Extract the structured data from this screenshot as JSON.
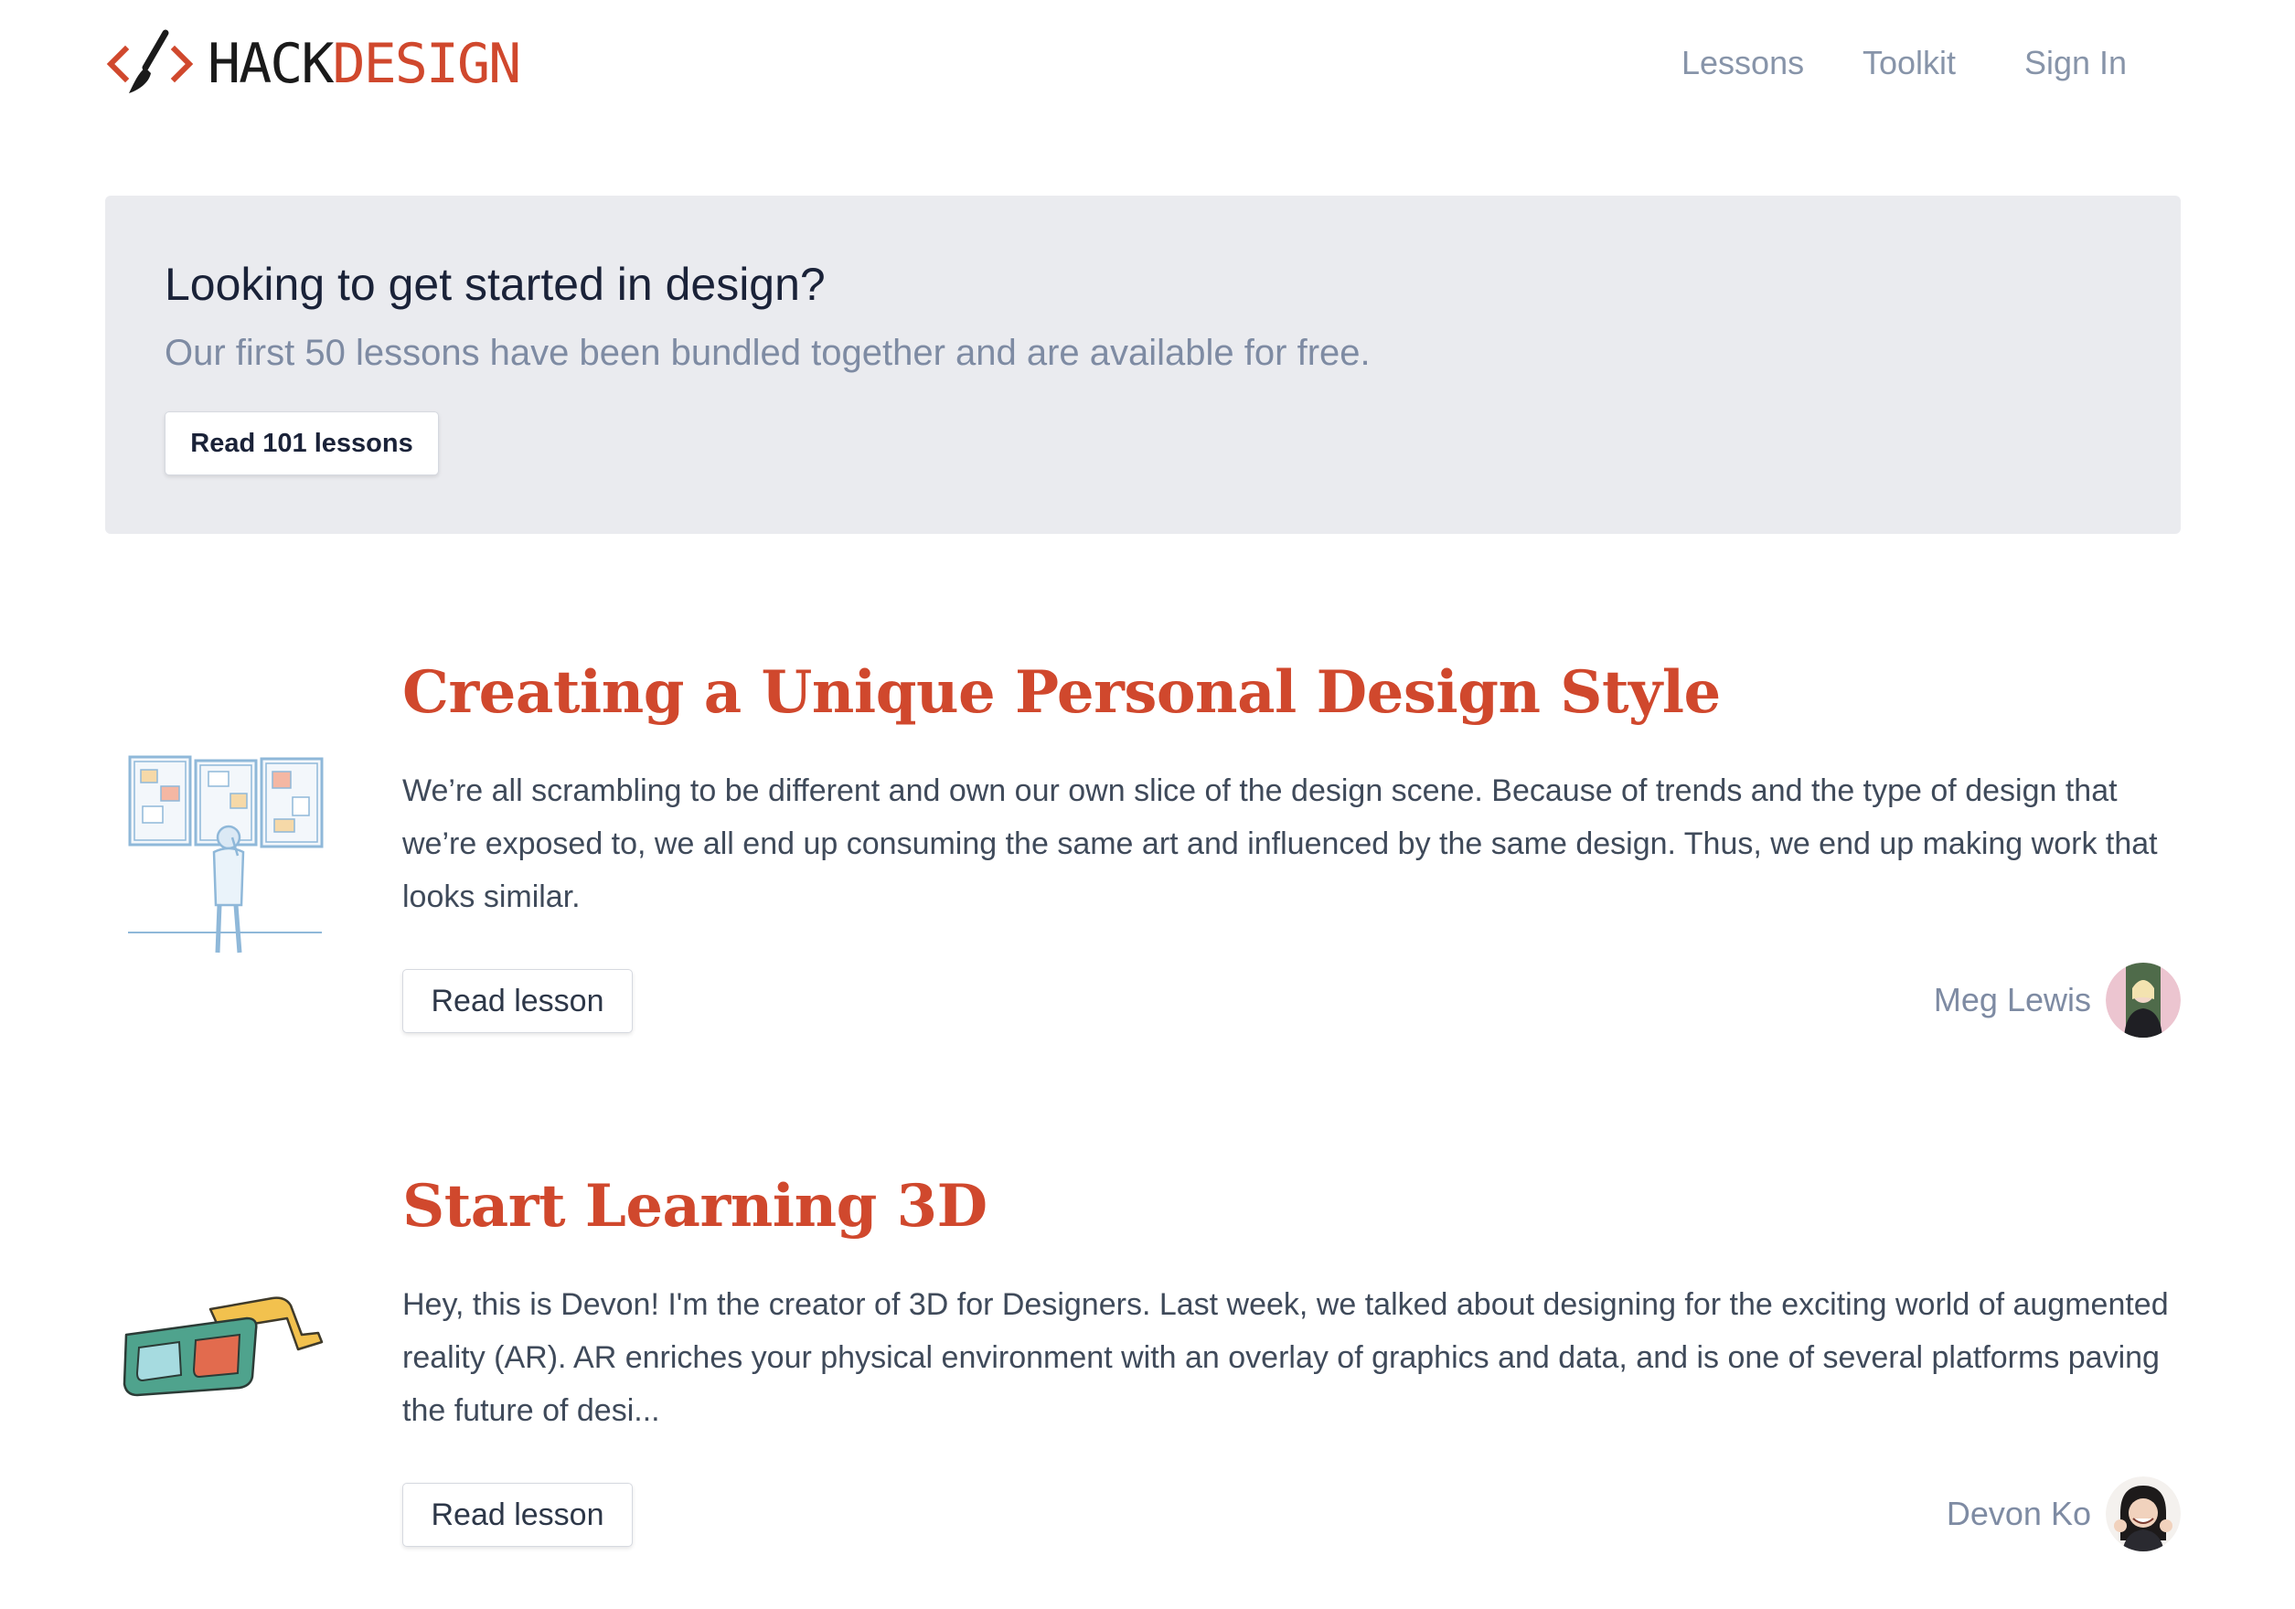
{
  "header": {
    "logo": {
      "hack": "HACK",
      "design": "DESIGN",
      "icon": "code-brackets-brush-icon"
    },
    "nav": [
      {
        "label": "Lessons"
      },
      {
        "label": "Toolkit"
      },
      {
        "label": "Sign In"
      }
    ]
  },
  "banner": {
    "title": "Looking to get started in design?",
    "subtitle": "Our first 50 lessons have been bundled together and are available for free.",
    "button_label": "Read 101 lessons"
  },
  "lessons": [
    {
      "title": "Creating a Unique Personal Design Style",
      "excerpt": "We’re all scrambling to be different and own our own slice of the design scene. Because of trends and the type of design that we’re exposed to, we all end up consuming the same art and influenced by the same design. Thus, we end up making work that looks similar.",
      "button_label": "Read lesson",
      "author": "Meg Lewis",
      "illustration": "person-viewing-gallery-illustration"
    },
    {
      "title": "Start Learning 3D",
      "excerpt": "Hey, this is Devon! I'm the creator of 3D for Designers. Last week, we talked about designing for the exciting world of augmented reality (AR). AR enriches your physical environment with an overlay of graphics and data, and is one of several platforms paving the future of desi...",
      "button_label": "Read lesson",
      "author": "Devon Ko",
      "illustration": "3d-glasses-illustration"
    }
  ],
  "colors": {
    "brand_red": "#d0482d",
    "nav_gray": "#8794a9",
    "banner_bg": "#eaebef",
    "text_dark": "#1a2238"
  }
}
